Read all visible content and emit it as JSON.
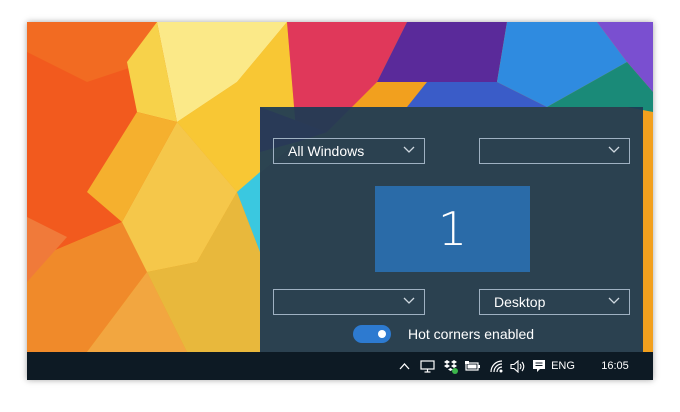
{
  "panel": {
    "top_left_corner": {
      "value": "All Windows"
    },
    "top_right_corner": {
      "value": ""
    },
    "bottom_left_corner": {
      "value": ""
    },
    "bottom_right_corner": {
      "value": "Desktop"
    },
    "monitor_number": "1",
    "hot_corners_toggle": {
      "label": "Hot corners enabled",
      "enabled": true
    }
  },
  "taskbar": {
    "icons": [
      "chevron-up-icon",
      "display-icon",
      "dropbox-icon",
      "battery-icon",
      "wifi-icon",
      "volume-icon",
      "action-center-icon"
    ],
    "language": "ENG",
    "time": "16:05"
  },
  "colors": {
    "panel_bg": "#1c3a54",
    "monitor_fill": "#2a6ba8",
    "toggle_on": "#2d7ad0",
    "taskbar_bg": "#0d1a24"
  }
}
